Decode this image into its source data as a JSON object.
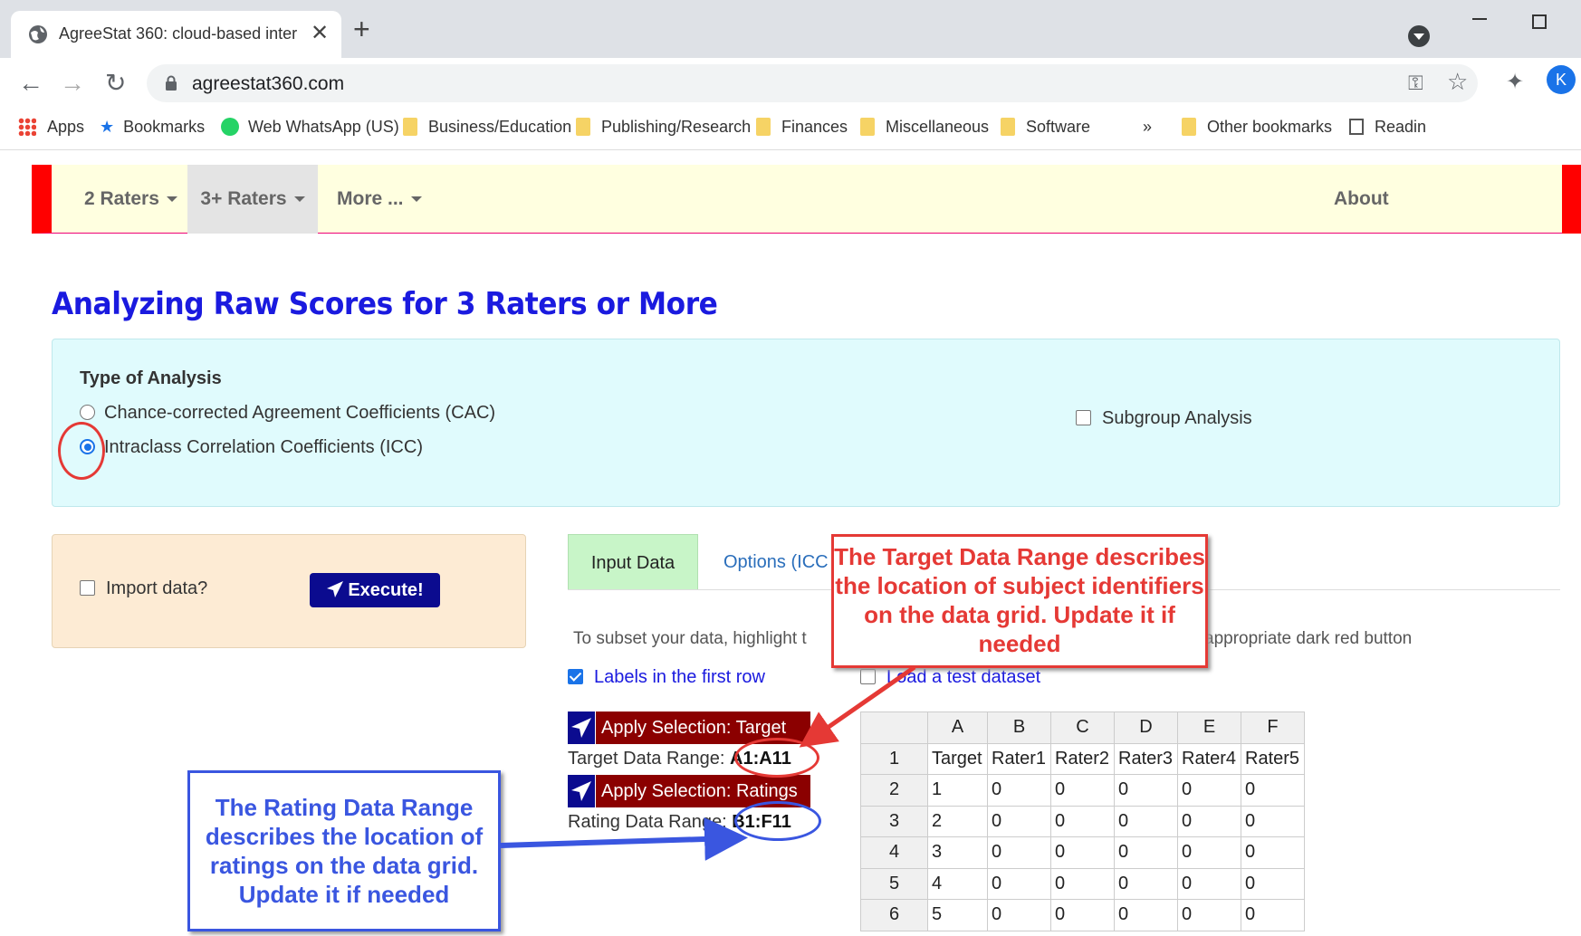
{
  "browser": {
    "tab_title": "AgreeStat 360: cloud-based inter",
    "url": "agreestat360.com",
    "avatar_letter": "K",
    "bookmarks": [
      {
        "label": "Apps",
        "icon": "apps-grid-icon"
      },
      {
        "label": "Bookmarks",
        "icon": "star-icon"
      },
      {
        "label": "Web WhatsApp (US)",
        "icon": "whatsapp-icon"
      },
      {
        "label": "Business/Education",
        "icon": "folder-icon"
      },
      {
        "label": "Publishing/Research",
        "icon": "folder-icon"
      },
      {
        "label": "Finances",
        "icon": "folder-icon"
      },
      {
        "label": "Miscellaneous",
        "icon": "folder-icon"
      },
      {
        "label": "Software",
        "icon": "folder-icon"
      }
    ],
    "bookmarks_overflow": "»",
    "other_bookmarks": "Other bookmarks",
    "reading_list": "Readin"
  },
  "navbar": {
    "items": [
      "2 Raters",
      "3+ Raters",
      "More ..."
    ],
    "about": "About"
  },
  "page": {
    "title": "Analyzing Raw Scores for 3 Raters or More"
  },
  "analysis": {
    "label": "Type of Analysis",
    "options": [
      {
        "label": "Chance-corrected Agreement Coefficients (CAC)",
        "checked": false
      },
      {
        "label": "Intraclass Correlation Coefficients (ICC)",
        "checked": true
      }
    ],
    "subgroup_label": "Subgroup Analysis"
  },
  "import": {
    "label": "Import data?",
    "execute_label": "Execute!"
  },
  "tabs": {
    "input_data": "Input Data",
    "options": "Options (ICC"
  },
  "input": {
    "subset_text": "To subset your data, highlight t",
    "subset_tail": "appropriate dark red button",
    "labels_first_row": "Labels in the first row",
    "load_test": "Load a test dataset",
    "apply_target": "Apply Selection: Target",
    "target_range_label": "Target Data Range:",
    "target_range_value": "A1:A11",
    "apply_ratings": "Apply Selection: Ratings",
    "rating_range_label": "Rating Data Range:",
    "rating_range_value": "B1:F11"
  },
  "grid": {
    "columns": [
      "A",
      "B",
      "C",
      "D",
      "E",
      "F"
    ],
    "rows": [
      {
        "n": "1",
        "cells": [
          "Target",
          "Rater1",
          "Rater2",
          "Rater3",
          "Rater4",
          "Rater5"
        ]
      },
      {
        "n": "2",
        "cells": [
          "1",
          "0",
          "0",
          "0",
          "0",
          "0"
        ]
      },
      {
        "n": "3",
        "cells": [
          "2",
          "0",
          "0",
          "0",
          "0",
          "0"
        ]
      },
      {
        "n": "4",
        "cells": [
          "3",
          "0",
          "0",
          "0",
          "0",
          "0"
        ]
      },
      {
        "n": "5",
        "cells": [
          "4",
          "0",
          "0",
          "0",
          "0",
          "0"
        ]
      },
      {
        "n": "6",
        "cells": [
          "5",
          "0",
          "0",
          "0",
          "0",
          "0"
        ]
      }
    ]
  },
  "annotations": {
    "target_callout": "The Target Data Range describes the location of subject identifiers on the data grid. Update it if needed",
    "rating_callout": "The Rating Data Range describes the location of ratings on the data grid. Update it if needed"
  },
  "colors": {
    "title_blue": "#1a1adf",
    "execute_navy": "#0b0b8f",
    "apply_darkred": "#8b0000",
    "callout_red": "#e53935",
    "callout_blue": "#3a56e0"
  }
}
